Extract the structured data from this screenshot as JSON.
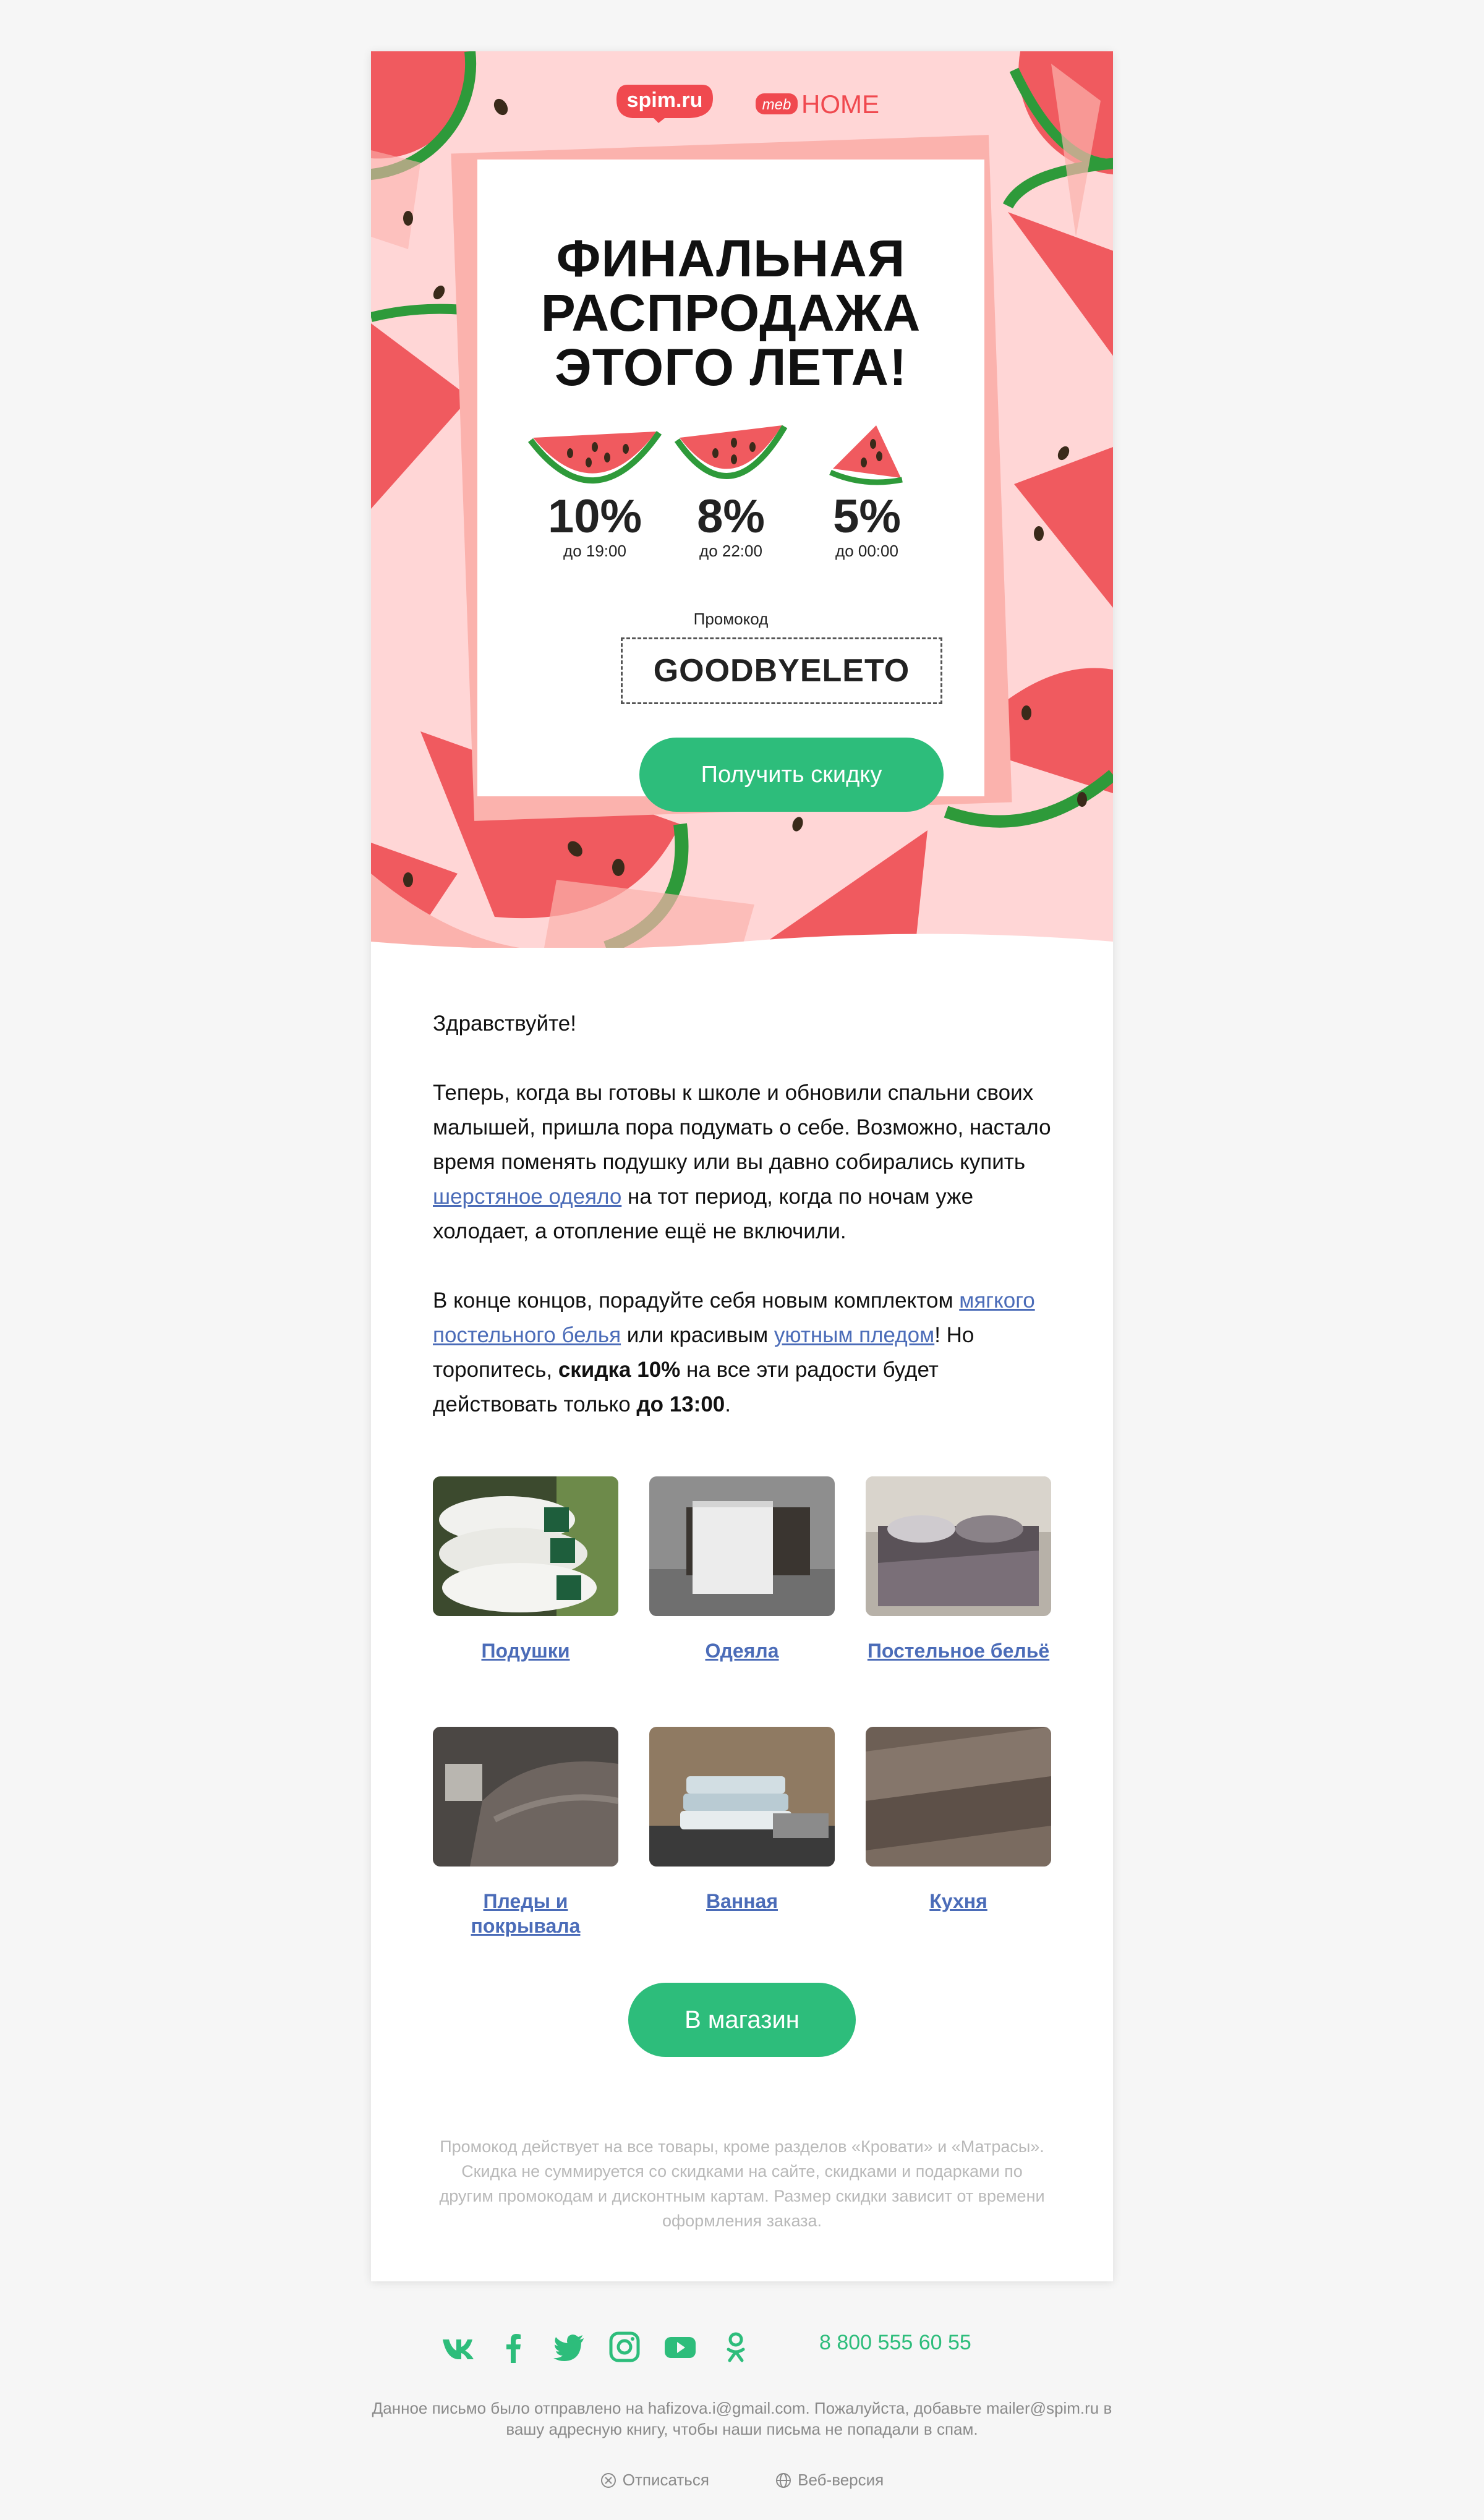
{
  "hero": {
    "logo_spim": "spim.ru",
    "logo_meb": "meb",
    "logo_home": "HOME",
    "title_lines": [
      "ФИНАЛЬНАЯ",
      "РАСПРОДАЖА",
      "ЭТОГО ЛЕТА!"
    ],
    "discounts": [
      {
        "percent": "10%",
        "time": "до 19:00"
      },
      {
        "percent": "8%",
        "time": "до 22:00"
      },
      {
        "percent": "5%",
        "time": "до 00:00"
      }
    ],
    "promo_label": "Промокод",
    "promo_code": "GOODBYELETO",
    "cta": "Получить скидку"
  },
  "body": {
    "greeting": "Здравствуйте!",
    "p1_a": "Теперь, когда вы готовы к школе и обновили спальни своих малышей, пришла пора подумать о себе. Возможно, настало время поменять подушку или вы давно собирались купить ",
    "p1_link": "шерстяное одеяло",
    "p1_b": " на тот период, когда по ночам уже холодает, а отопление ещё не включили.",
    "p2_a": "В конце концов, порадуйте себя новым комплектом ",
    "p2_link1": "мягкого постельного белья",
    "p2_b": " или красивым ",
    "p2_link2": "уютным пледом",
    "p2_c": "! Но торопитесь, ",
    "p2_bold1": "скидка 10%",
    "p2_d": " на все эти радости будет действовать только ",
    "p2_bold2": "до 13:00",
    "p2_e": "."
  },
  "categories": [
    {
      "label": "Подушки"
    },
    {
      "label": "Одеяла"
    },
    {
      "label": "Постельное бельё"
    },
    {
      "label": "Пледы и покрывала"
    },
    {
      "label": "Ванная"
    },
    {
      "label": "Кухня"
    }
  ],
  "shop_button": "В магазин",
  "disclaimer": "Промокод действует на все товары, кроме разделов «Кровати» и «Матрасы». Скидка не суммируется со скидками на сайте, скидками и подарками по другим промокодам и дисконтным картам. Размер скидки зависит от времени оформления заказа.",
  "footer": {
    "social_icons": [
      "vk-icon",
      "facebook-icon",
      "twitter-icon",
      "instagram-icon",
      "youtube-icon",
      "odnoklassniki-icon"
    ],
    "phone": "8 800 555 60 55",
    "note": "Данное письмо было отправлено на hafizova.i@gmail.com. Пожалуйста, добавьте mailer@spim.ru в вашу адресную книгу, чтобы наши письма не попадали в спам.",
    "unsubscribe": "Отписаться",
    "web_version": "Веб-версия"
  },
  "colors": {
    "accent_green": "#2dbd7b",
    "link_blue": "#4b6cb8",
    "hero_pink": "#ffd6d6",
    "watermelon_red": "#f0494f"
  }
}
